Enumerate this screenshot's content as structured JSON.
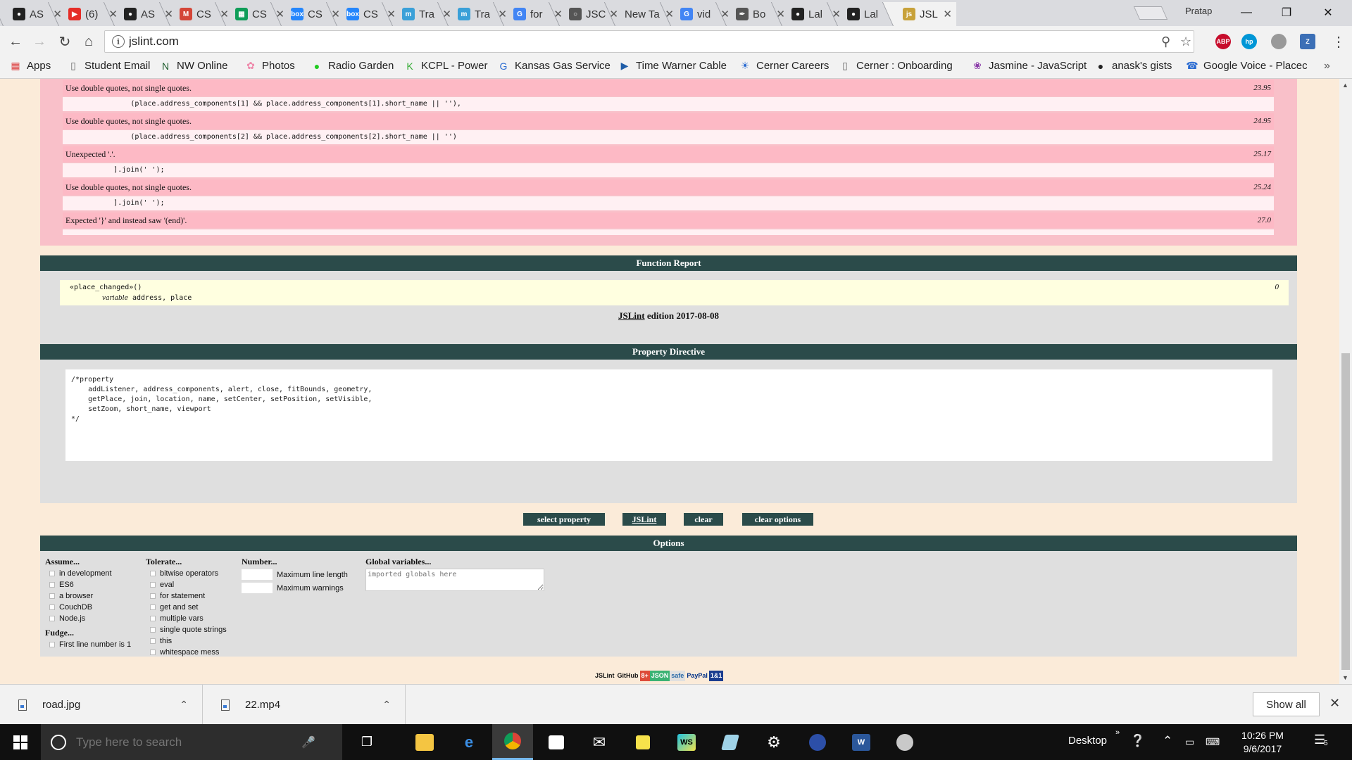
{
  "browser": {
    "tabs": [
      {
        "title": "AS",
        "icon": "github-icon",
        "color": "#222222"
      },
      {
        "title": "(6)",
        "icon": "youtube-icon",
        "color": "#e52d27"
      },
      {
        "title": "AS",
        "icon": "github-icon",
        "color": "#222222"
      },
      {
        "title": "CS",
        "icon": "gmail-icon",
        "color": "#d44638"
      },
      {
        "title": "CS",
        "icon": "sheets-icon",
        "color": "#0f9d58"
      },
      {
        "title": "CS",
        "icon": "box-icon",
        "color": "#2486fc"
      },
      {
        "title": "CS",
        "icon": "box-icon",
        "color": "#2486fc"
      },
      {
        "title": "Tra",
        "icon": "m-icon",
        "color": "#3aa0d8"
      },
      {
        "title": "Tra",
        "icon": "m-icon",
        "color": "#3aa0d8"
      },
      {
        "title": "for",
        "icon": "google-icon",
        "color": "#4285f4"
      },
      {
        "title": "JSC",
        "icon": "circle-icon",
        "color": "#555555"
      },
      {
        "title": "New Ta",
        "icon": "",
        "color": ""
      },
      {
        "title": "vid",
        "icon": "google-icon",
        "color": "#4285f4"
      },
      {
        "title": "Bo",
        "icon": "feather-icon",
        "color": "#555555"
      },
      {
        "title": "Lal",
        "icon": "github-icon",
        "color": "#222222"
      },
      {
        "title": "Lal",
        "icon": "github-icon",
        "color": "#222222"
      },
      {
        "title": "JSL",
        "icon": "jslint-icon",
        "color": "#c8a23a",
        "active": true
      }
    ],
    "profile": "Pratap",
    "url": "jslint.com",
    "bookmarks": [
      {
        "label": "Apps",
        "icon": "apps-grid-icon"
      },
      {
        "label": "Student Email",
        "icon": "page-icon"
      },
      {
        "label": "NW Online",
        "icon": "n-icon"
      },
      {
        "label": "Photos",
        "icon": "pinwheel-icon"
      },
      {
        "label": "Radio Garden",
        "icon": "dot-icon"
      },
      {
        "label": "KCPL - Power",
        "icon": "k-icon"
      },
      {
        "label": "Kansas Gas Service",
        "icon": "g-icon"
      },
      {
        "label": "Time Warner Cable",
        "icon": "play-icon"
      },
      {
        "label": "Cerner Careers",
        "icon": "bulb-icon"
      },
      {
        "label": "Cerner : Onboarding",
        "icon": "page-icon"
      },
      {
        "label": "Jasmine - JavaScript",
        "icon": "jasmine-icon"
      },
      {
        "label": "anask's gists",
        "icon": "github-icon"
      },
      {
        "label": "Google Voice - Placec",
        "icon": "voice-icon"
      }
    ],
    "extensions": [
      {
        "name": "abp",
        "label": "ABP",
        "color": "#c70d2c"
      },
      {
        "name": "hp",
        "label": "hp",
        "color": "#0096d6"
      },
      {
        "name": "puzzle",
        "label": "",
        "color": "#999999"
      },
      {
        "name": "z",
        "label": "Z",
        "color": "#3b6fb6"
      }
    ]
  },
  "warnings": [
    {
      "message": "Use double quotes, not single quotes.",
      "location": "23.95",
      "code": "                (place.address_components[1] && place.address_components[1].short_name || ''),"
    },
    {
      "message": "Use double quotes, not single quotes.",
      "location": "24.95",
      "code": "                (place.address_components[2] && place.address_components[2].short_name || '')"
    },
    {
      "message": "Unexpected '.'.",
      "location": "25.17",
      "code": "            ].join(' ');"
    },
    {
      "message": "Use double quotes, not single quotes.",
      "location": "25.24",
      "code": "            ].join(' ');"
    },
    {
      "message": "Expected '}' and instead saw '(end)'.",
      "location": "27.0",
      "code": ""
    }
  ],
  "function_report": {
    "title": "Function Report",
    "function_name": "«place_changed»()",
    "variable_label": "variable",
    "variables": "address, place",
    "count": "0",
    "edition_link": "JSLint",
    "edition_text": " edition 2017-08-08"
  },
  "property_directive": {
    "title": "Property Directive",
    "text": "/*property\n    addListener, address_components, alert, close, fitBounds, geometry,\n    getPlace, join, location, name, setCenter, setPosition, setVisible,\n    setZoom, short_name, viewport\n*/"
  },
  "buttons": {
    "select_property": "select property",
    "jslint": "JSLint",
    "clear": "clear",
    "clear_options": "clear options"
  },
  "options": {
    "title": "Options",
    "assume": {
      "title": "Assume...",
      "items": [
        "in development",
        "ES6",
        "a browser",
        "CouchDB",
        "Node.js"
      ]
    },
    "fudge": {
      "title": "Fudge...",
      "items": [
        "First line number is 1"
      ]
    },
    "tolerate": {
      "title": "Tolerate...",
      "items": [
        "bitwise operators",
        "eval",
        "for statement",
        "get and set",
        "multiple vars",
        "single quote strings",
        "this",
        "whitespace mess"
      ]
    },
    "number": {
      "title": "Number...",
      "items": [
        "Maximum line length",
        "Maximum warnings"
      ]
    },
    "globals": {
      "title": "Global variables...",
      "placeholder": "imported globals here"
    }
  },
  "footer_badges": [
    {
      "label": "JSLint",
      "bg": "#fbebd9",
      "fg": "#111111"
    },
    {
      "label": "GitHub",
      "bg": "#fbebd9",
      "fg": "#111111"
    },
    {
      "label": "8+",
      "bg": "#dd4b39",
      "fg": "#ffffff"
    },
    {
      "label": "JSON",
      "bg": "#3bb273",
      "fg": "#ffffff"
    },
    {
      "label": "safe",
      "bg": "#e0e0e0",
      "fg": "#2a6aa8"
    },
    {
      "label": "PayPal",
      "bg": "#fbebd9",
      "fg": "#003087"
    },
    {
      "label": "1&1",
      "bg": "#1a3c8f",
      "fg": "#ffffff"
    }
  ],
  "downloads": {
    "items": [
      "road.jpg",
      "22.mp4"
    ],
    "show_all": "Show all"
  },
  "taskbar": {
    "search_placeholder": "Type here to search",
    "desktop_label": "Desktop",
    "time": "10:26 PM",
    "date": "9/6/2017",
    "notification_count": "5"
  }
}
